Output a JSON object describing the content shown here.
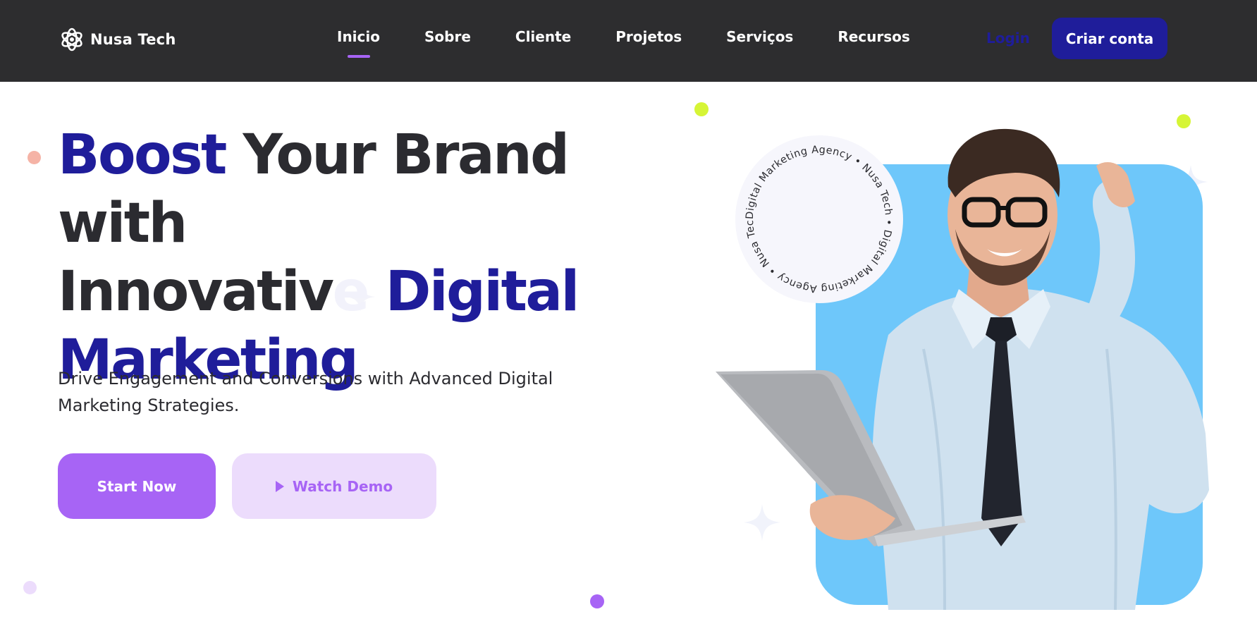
{
  "brand": {
    "name": "Nusa Tech",
    "logo_icon": "atom-icon"
  },
  "nav": {
    "links": [
      {
        "label": "Inicio",
        "active": true
      },
      {
        "label": "Sobre",
        "active": false
      },
      {
        "label": "Cliente",
        "active": false
      },
      {
        "label": "Projetos",
        "active": false
      },
      {
        "label": "Serviços",
        "active": false
      },
      {
        "label": "Recursos",
        "active": false
      }
    ],
    "login_label": "Login",
    "signup_label": "Criar conta"
  },
  "hero": {
    "title_part1_accent": "Boost",
    "title_part2": " Your Brand with",
    "title_part3": "Innovativ",
    "title_part4_faded": "e",
    "title_part5_accent": " Digital",
    "title_part6_accent": "Marketing",
    "subtitle": "Drive Engagement and Conversions with Advanced Digital Marketing Strategies.",
    "start_label": "Start Now",
    "demo_label": "Watch Demo",
    "badge_text": "Digital Marketing Agency • Nusa Tech • Digital Marketing Agency • Nusa Tech • "
  },
  "colors": {
    "navbar_bg": "#2d2d2f",
    "accent_navy": "#1f1d9a",
    "accent_purple": "#a764f5",
    "panel_blue": "#6ec7fa",
    "lime": "#d6f536"
  }
}
